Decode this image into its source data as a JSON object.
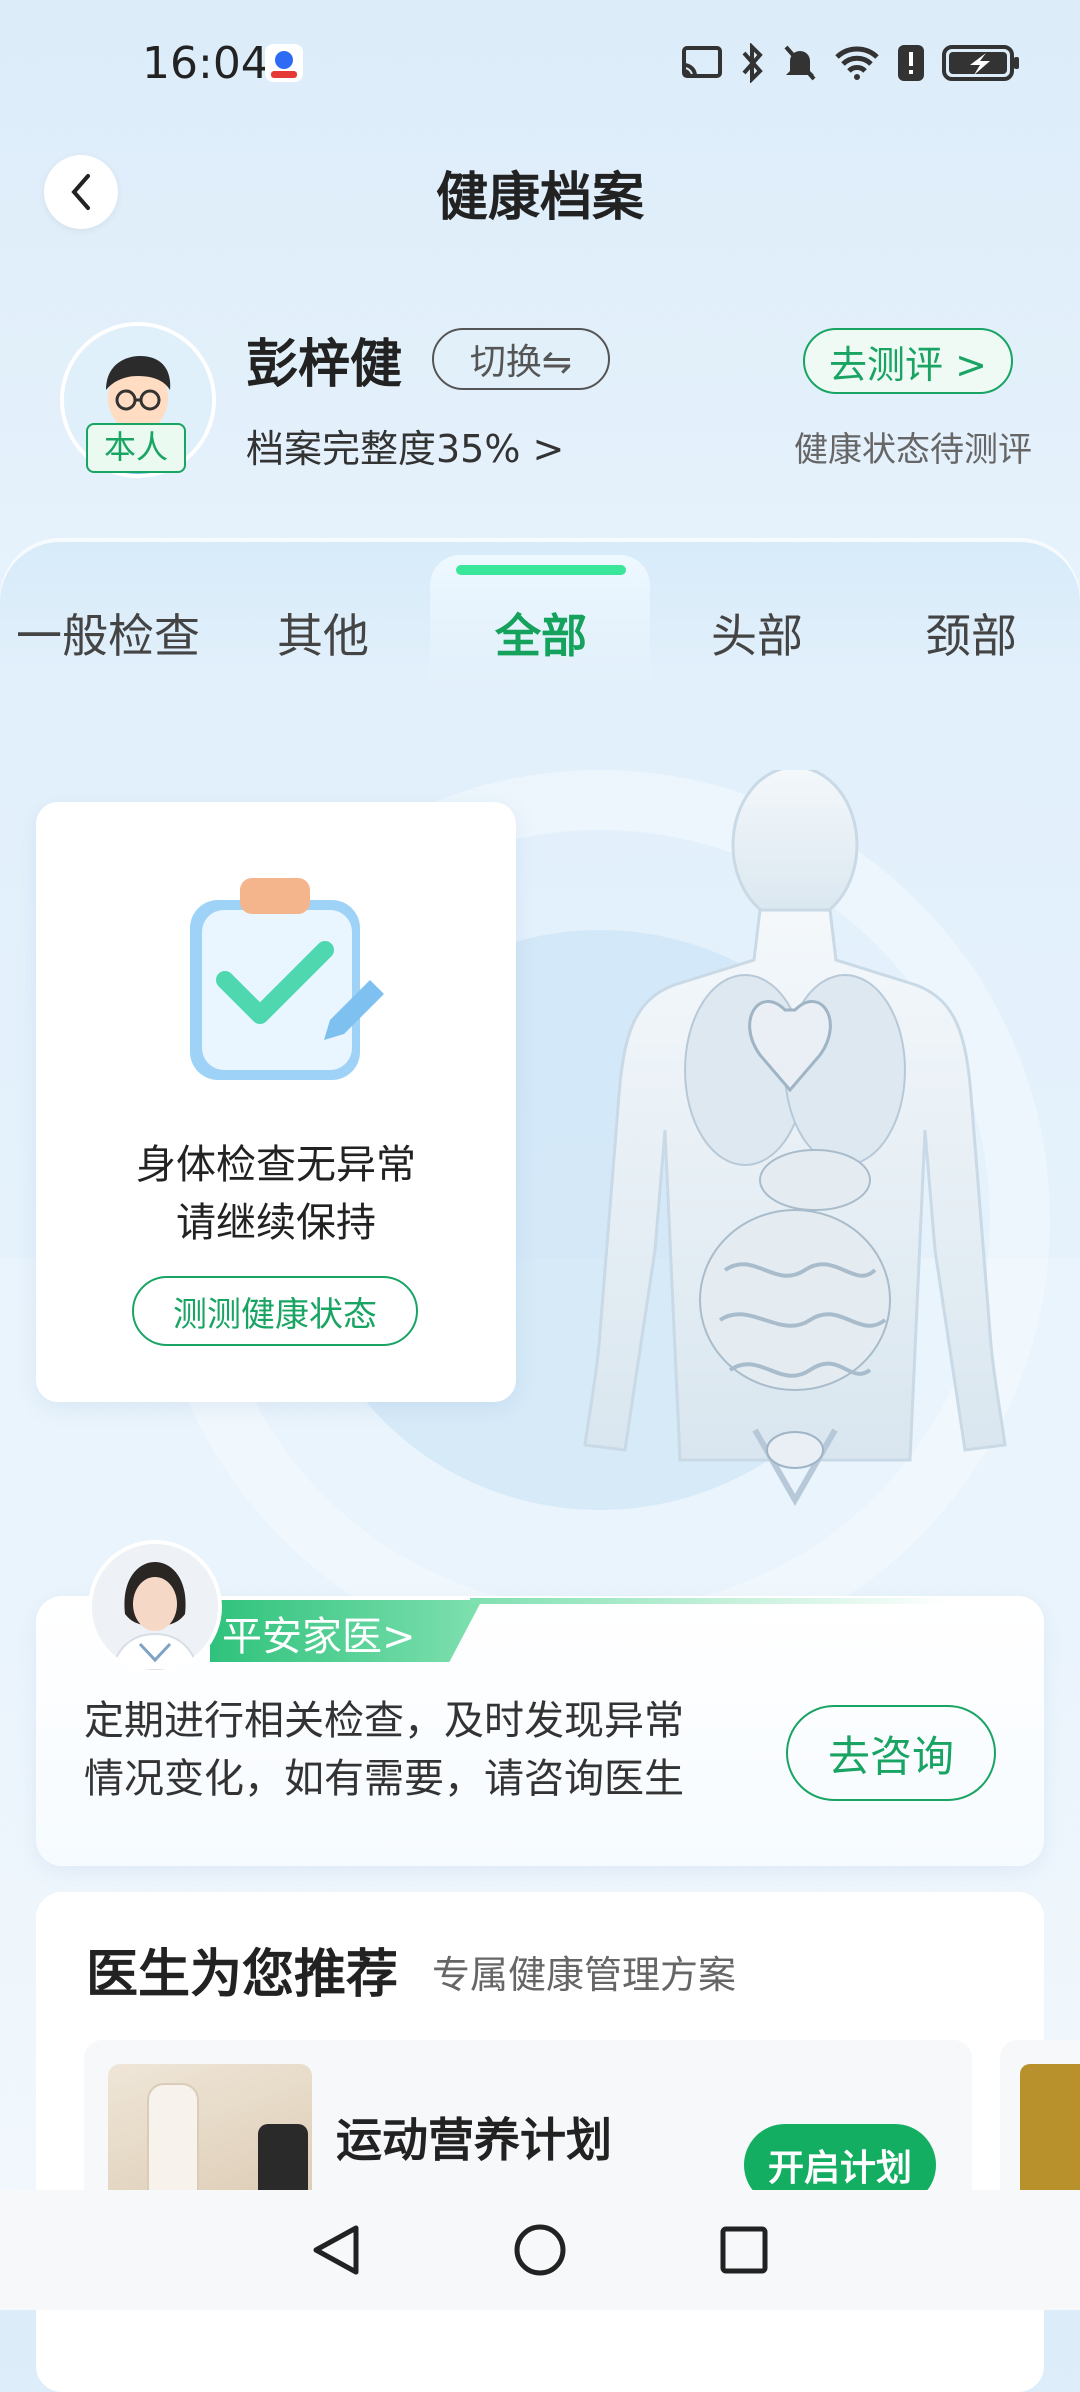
{
  "status_bar": {
    "time": "16:04",
    "icons": [
      "cast-icon",
      "bluetooth-icon",
      "mute-icon",
      "wifi-icon",
      "alert-icon",
      "battery-charging-icon"
    ]
  },
  "header": {
    "title": "健康档案"
  },
  "profile": {
    "name": "彭梓健",
    "switch_label": "切换⇋",
    "self_badge": "本人",
    "completeness": "档案完整度35% >",
    "assess_label": "去测评 >",
    "pending_status": "健康状态待测评"
  },
  "tabs": [
    {
      "label": "一般检查"
    },
    {
      "label": "其他"
    },
    {
      "label": "全部",
      "active": true
    },
    {
      "label": "头部"
    },
    {
      "label": "颈部"
    }
  ],
  "status_card": {
    "line1": "身体检查无异常",
    "line2": "请继续保持",
    "button": "测测健康状态"
  },
  "doctor_card": {
    "tag": "平安家医>",
    "line1": "定期进行相关检查，及时发现异常",
    "line2": "情况变化，如有需要，请咨询医生",
    "button": "去咨询"
  },
  "recommend": {
    "title": "医生为您推荐",
    "subtitle": "专属健康管理方案",
    "items": [
      {
        "name": "运动营养计划",
        "button": "开启计划"
      }
    ]
  },
  "colors": {
    "accent": "#19a463",
    "accent_bright": "#3ae69a",
    "background": "#e4f1fb"
  }
}
